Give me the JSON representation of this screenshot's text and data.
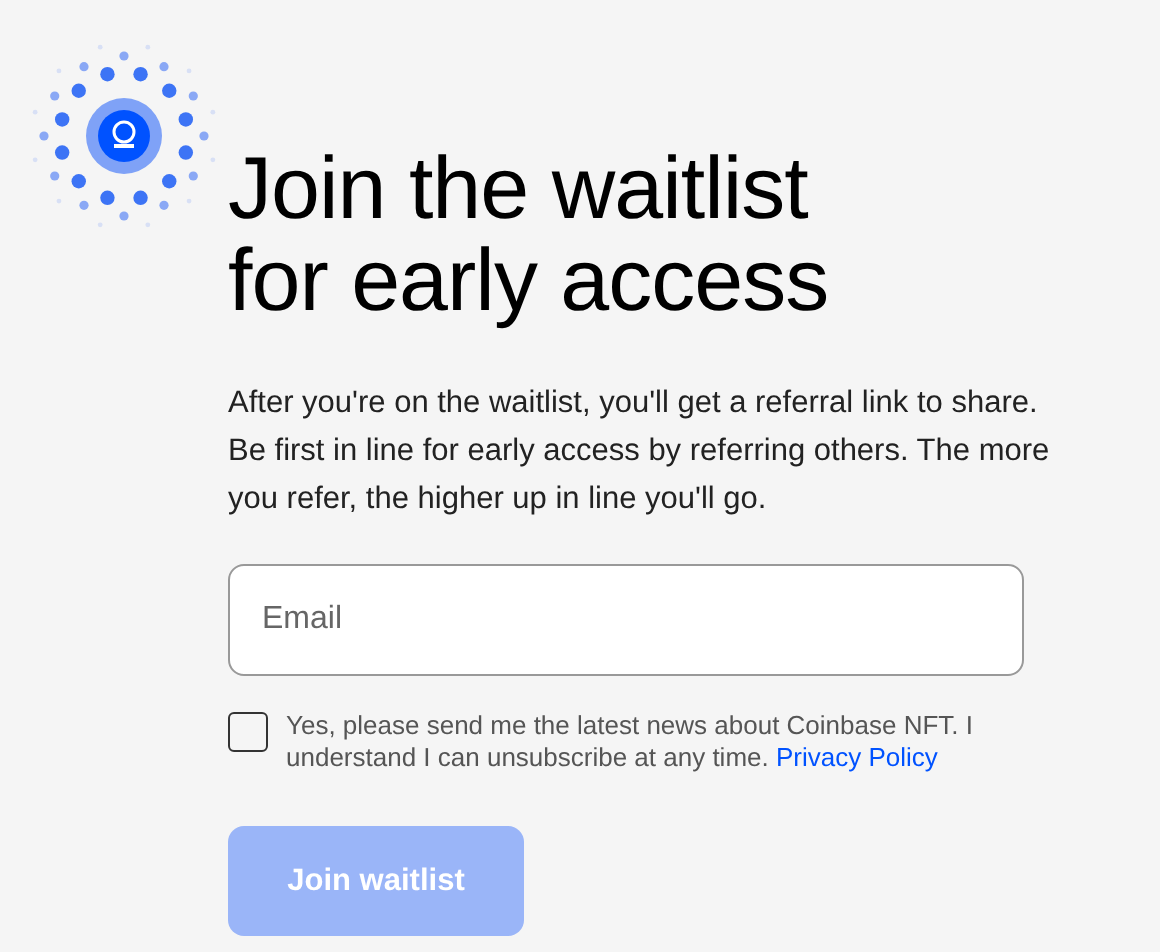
{
  "heading": [
    "Join the waitlist",
    "for early access"
  ],
  "description": "After you're on the waitlist, you'll get a referral link to share. Be first in line for early access by referring others. The more you refer, the higher up in line you'll go.",
  "email_field": {
    "placeholder": "Email"
  },
  "consent": {
    "checked": false,
    "text": "Yes, please send me the latest news about Coinbase NFT. I understand I can unsubscribe at any time.",
    "link": "Privacy Policy"
  },
  "submit_button": {
    "label": "Join waitlist",
    "disabled": true
  }
}
